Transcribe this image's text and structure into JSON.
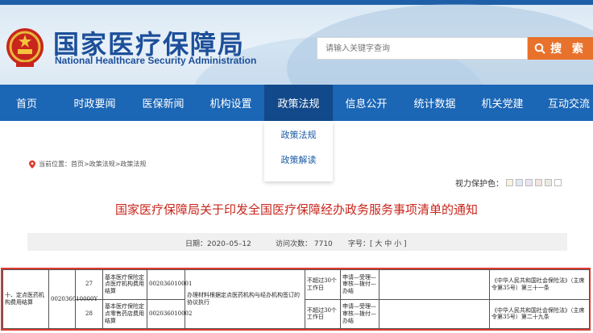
{
  "site": {
    "name_cn": "国家医疗保障局",
    "name_en": "National Healthcare Security Administration"
  },
  "search": {
    "placeholder": "请输入关键字查询",
    "button_label": "搜 索"
  },
  "nav": {
    "items": [
      {
        "label": "首页"
      },
      {
        "label": "时政要闻"
      },
      {
        "label": "医保新闻"
      },
      {
        "label": "机构设置"
      },
      {
        "label": "政策法规"
      },
      {
        "label": "信息公开"
      },
      {
        "label": "统计数据"
      },
      {
        "label": "机关党建"
      },
      {
        "label": "互动交流"
      }
    ],
    "active_label": "政策法规"
  },
  "dropdown": {
    "items": [
      {
        "label": "政策法规"
      },
      {
        "label": "政策解读"
      }
    ]
  },
  "breadcrumb": {
    "text": "当前位置：首页>政策法规>政策法规"
  },
  "vision": {
    "label": "视力保护色：",
    "swatches": [
      "#f7f3e0",
      "#dfe9f7",
      "#e9e3f2",
      "#f3e3e3",
      "#e7ecdf",
      "#ffffff"
    ]
  },
  "article": {
    "title": "国家医疗保障局关于印发全国医疗保障经办政务服务事项清单的通知",
    "date": "日期：2020–05–12",
    "visits": "访问次数：  7710",
    "font_size": "字号：[ 大 中 小 ]"
  },
  "table": {
    "group_name": "十、定点医药机构费用结算",
    "group_code": "002036010000Y",
    "rows": [
      {
        "no": "27",
        "item": "基本医疗保险定点医疗机构费用结算",
        "code": "002036010001",
        "basis_materials": "办理材料根据定点医药机构与经办机构签订的协议执行",
        "time_limit": "不超过30个工作日",
        "process": "申请—受理—审核—拨付—办结",
        "law": "《中华人民共和国社会保险法》（主席令第35号）第三十一条"
      },
      {
        "no": "28",
        "item": "基本医疗保险定点零售药店费用结算",
        "code": "002036010002",
        "time_limit": "不超过30个工作日",
        "process": "申请—受理—审核—拨付—办结",
        "law": "《中华人民共和国社会保险法》（主席令第35号）第二十九条"
      }
    ]
  },
  "colors": {
    "nav_bg": "#1b66b5",
    "nav_active": "#12498a",
    "title_red": "#c8261c",
    "search_orange": "#e8712b",
    "highlight_border": "#e0392f"
  }
}
